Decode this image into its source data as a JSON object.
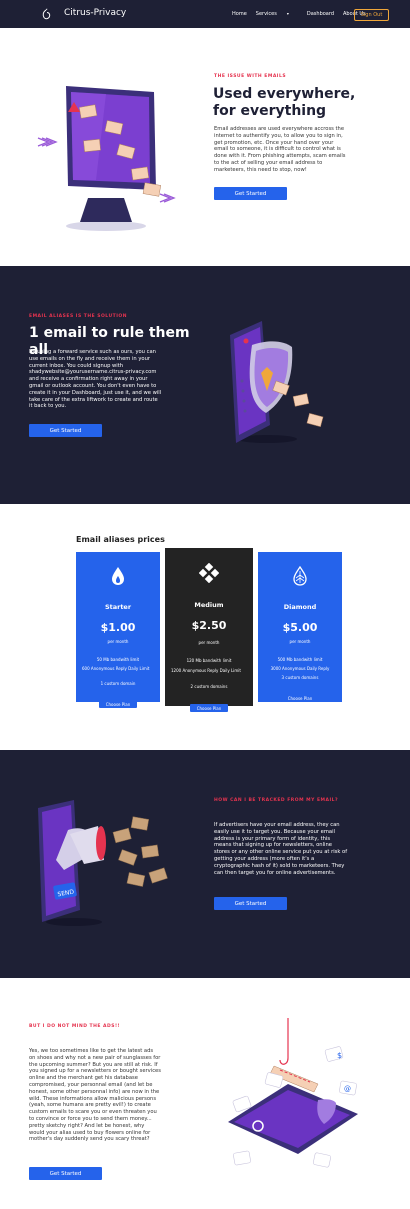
{
  "nav": {
    "brand": "Citrus-Privacy",
    "links": [
      "Home",
      "Services",
      "Dashboard",
      "About Us"
    ],
    "signout": "Sign Out"
  },
  "s1": {
    "eyebrow": "THE ISSUE WITH EMAILS",
    "title": "Used everywhere, for everything",
    "body": "Email addresses are used everywhere accross the internet to authentify you, to allow you to sign in, get promotion, etc. Once your hand over your email to someone, it is difficult to control what is done with it. From phishing attempts, scam emails to the act of selling your email address to marketeers, this need to stop, now!",
    "button": "Get Started"
  },
  "s2": {
    "eyebrow": "EMAIL ALIASES IS THE SOLUTION",
    "title": "1 email to rule them all",
    "body": "By using a forward service such as ours, you can use emails on the fly and receive them in your current inbox. You could signup with shadywebsite@yourusername.citrus-privacy.com and receive a confirmation right away in your gmail or outlook account. You don't even have to create it in your Dashboard, just use it, and we will take care of the extra liftwork to create and route it back to you.",
    "button": "Get Started"
  },
  "pricing": {
    "title": "Email aliases prices",
    "plans": [
      {
        "name": "Starter",
        "price": "$1.00",
        "per": "per month",
        "features": [
          "50 Mb bandwith limit",
          "600 Anonymous Reply Daily Limit",
          "1 custom domain"
        ],
        "button": "Choose Plan"
      },
      {
        "name": "Medium",
        "price": "$2.50",
        "per": "per month",
        "features": [
          "120 Mb bandwith limit",
          "1200 Anonymous Reply Daily Limit",
          "2 custom domains"
        ],
        "button": "Choose Plan"
      },
      {
        "name": "Diamond",
        "price": "$5.00",
        "per": "per month",
        "features": [
          "500 Mb bandwith limit",
          "3000 Anonymous Daily Reply",
          "3 custom domains"
        ],
        "button": "Choose Plan"
      }
    ]
  },
  "s4": {
    "eyebrow": "HOW CAN I BE TRACKED FROM MY EMAIL?",
    "body": "If advertisers have your email address, they can easily use it to target you. Because your email address is your primary form of identity, this means that signing up for newsletters, online stores or any other online service put you at risk of getting your address (more often it's a cryptographic hash of it) sold to marketeers. They can then target you for online advertisements.",
    "button": "Get Started"
  },
  "s5": {
    "eyebrow": "BUT I DO NOT MIND THE ADS!!",
    "body": "Yes, we too sometimes like to get the latest ads on shoes and why not a new pair of sunglasses for the upcoming summer? But you are still at risk. If you signed up for a newsletters or bought services online and the merchant get his database compromised, your personnal email (and let be honest, some other personnal info) are now in the wild. These informations allow malicious persons (yeah, some humans are pretty evil!) to create custom emails to scare you or even threaten you to convince or force you to send them money... pretty sketchy right? And let be honest, why would your alias used to buy flowers online for mother's day suddenly send you scary threat?",
    "button": "Get Started"
  },
  "colors": {
    "nav_bg": "#1e2035",
    "accent_red": "#e5334f",
    "primary_blue": "#2563eb",
    "signout_orange": "#f0a73a",
    "medium_card": "#232323"
  }
}
